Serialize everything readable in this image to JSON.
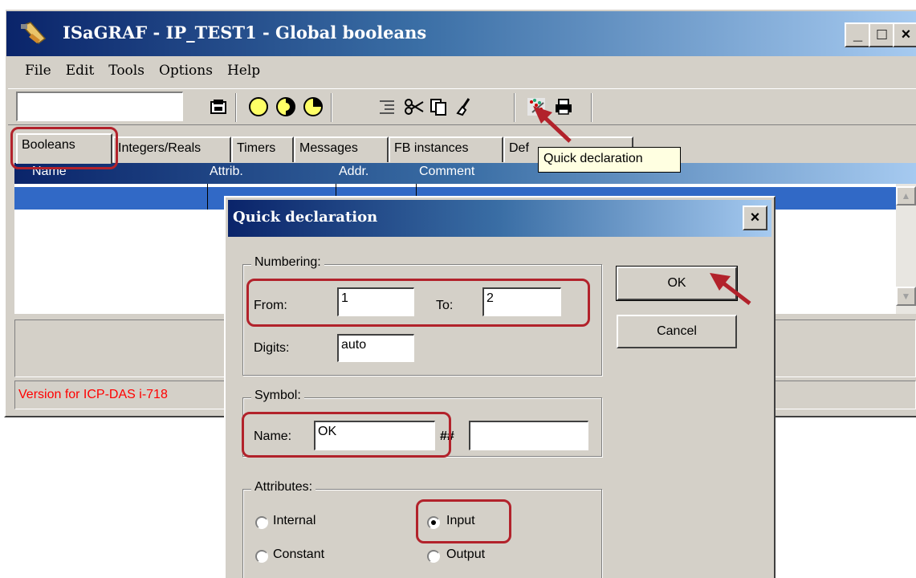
{
  "window": {
    "title": "ISaGRAF - IP_TEST1 - Global booleans",
    "controls": {
      "minimize": "_",
      "maximize": "□",
      "close": "×"
    }
  },
  "menu": [
    {
      "label": "File"
    },
    {
      "label": "Edit"
    },
    {
      "label": "Tools"
    },
    {
      "label": "Options"
    },
    {
      "label": "Help"
    }
  ],
  "toolbar": {
    "search_value": "",
    "icons": [
      "save-icon",
      "circle-empty-icon",
      "circle-half-icon",
      "circle-quarter-icon",
      "indent-icon",
      "cut-icon",
      "copy-icon",
      "clear-icon",
      "quick-declaration-icon",
      "print-icon"
    ]
  },
  "tabs": [
    {
      "label": "Booleans",
      "active": true
    },
    {
      "label": "Integers/Reals"
    },
    {
      "label": "Timers"
    },
    {
      "label": "Messages"
    },
    {
      "label": "FB instances"
    },
    {
      "label": "Def"
    }
  ],
  "list": {
    "columns": [
      "Name",
      "Attrib.",
      "Addr.",
      "Comment"
    ]
  },
  "status": {
    "text": "Version for ICP-DAS i-718"
  },
  "tooltip": {
    "text": "Quick declaration"
  },
  "dialog": {
    "title": "Quick declaration",
    "close": "×",
    "numbering": {
      "label": "Numbering:",
      "from_label": "From:",
      "from_value": "1",
      "to_label": "To:",
      "to_value": "2",
      "digits_label": "Digits:",
      "digits_value": "auto"
    },
    "symbol": {
      "label": "Symbol:",
      "name_label": "Name:",
      "name_value": "OK",
      "suffix_label": "##",
      "suffix_value": ""
    },
    "attributes": {
      "label": "Attributes:",
      "options": [
        {
          "label": "Internal",
          "selected": false
        },
        {
          "label": "Input",
          "selected": true
        },
        {
          "label": "Constant",
          "selected": false
        },
        {
          "label": "Output",
          "selected": false
        }
      ]
    },
    "buttons": {
      "ok": "OK",
      "cancel": "Cancel"
    }
  },
  "colors": {
    "highlight": "#b2222b",
    "titlebar": "#0a246a",
    "face": "#d4d0c8",
    "status_text": "#ff0000"
  }
}
